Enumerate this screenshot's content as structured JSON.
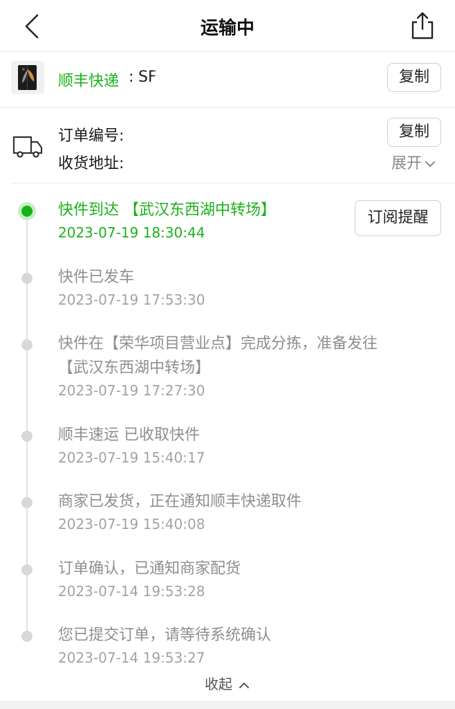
{
  "header": {
    "title": "运输中",
    "back_icon": "chevron-left-icon",
    "share_icon": "share-icon"
  },
  "express": {
    "carrier": "顺丰快递",
    "separator": ":",
    "tracking_prefix": "SF",
    "copy_label": "复制",
    "thumb_icon": "phone-thumbnail"
  },
  "order": {
    "icon": "truck-icon",
    "order_label": "订单编号:",
    "copy_label": "复制",
    "address_label": "收货地址:",
    "expand_label": "展开",
    "expand_icon": "chevron-down-icon"
  },
  "timeline": {
    "subscribe_label": "订阅提醒",
    "events": [
      {
        "text": "快件到达 【武汉东西湖中转场】",
        "time": "2023-07-19 18:30:44",
        "active": true
      },
      {
        "text": "快件已发车",
        "time": "2023-07-19 17:53:30",
        "active": false
      },
      {
        "text": "快件在【荣华项目营业点】完成分拣，准备发往",
        "text2": "【武汉东西湖中转场】",
        "time": "2023-07-19 17:27:30",
        "active": false
      },
      {
        "text": "顺丰速运 已收取快件",
        "time": "2023-07-19 15:40:17",
        "active": false
      },
      {
        "text": "商家已发货，正在通知顺丰快递取件",
        "time": "2023-07-19 15:40:08",
        "active": false
      },
      {
        "text": "订单确认，已通知商家配货",
        "time": "2023-07-14 19:53:28",
        "active": false
      },
      {
        "text": "您已提交订单，请等待系统确认",
        "time": "2023-07-14 19:53:27",
        "active": false
      }
    ],
    "collapse_label": "收起",
    "collapse_icon": "chevron-up-icon"
  },
  "colors": {
    "accent_green": "#1bb21b",
    "muted": "#8f8f8f"
  }
}
